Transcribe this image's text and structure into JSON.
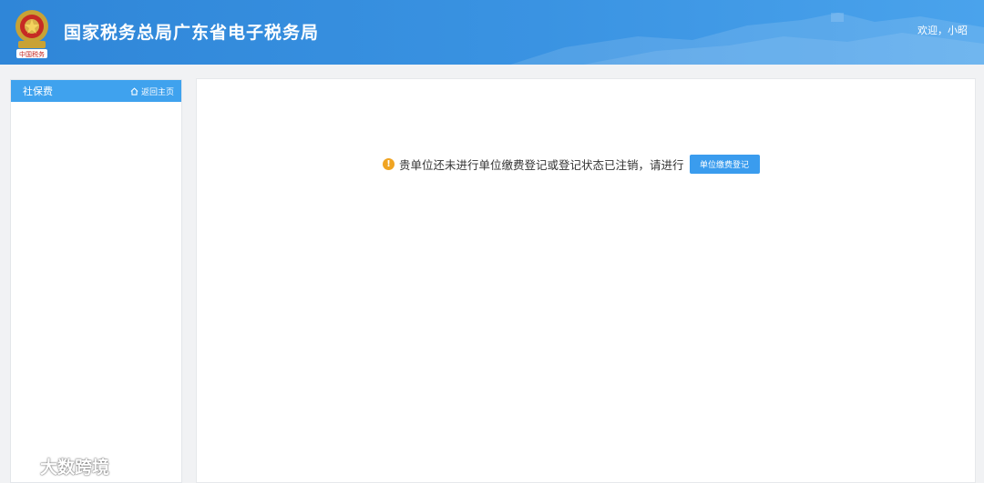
{
  "header": {
    "title": "国家税务总局广东省电子税务局",
    "welcome": "欢迎，小昭",
    "emblem_text": "中国税务",
    "background_color": "#3a93e2"
  },
  "sidebar": {
    "title": "社保费",
    "home_link": "返回主页",
    "home_icon": "home-icon",
    "header_color": "#3fa2ee"
  },
  "main": {
    "notice_text": "贵单位还未进行单位缴费登记或登记状态已注销，请进行",
    "notice_icon": "exclamation-icon",
    "button_label": "单位缴费登记",
    "button_color": "#3a9cee",
    "warning_color": "#f0a422"
  },
  "watermark": {
    "text": "大数跨境"
  }
}
